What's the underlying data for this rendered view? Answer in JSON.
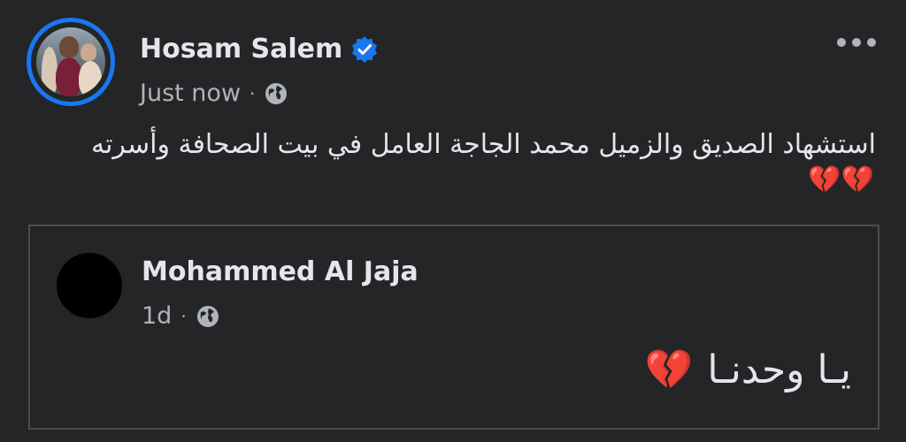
{
  "post": {
    "author": "Hosam Salem",
    "timestamp": "Just now",
    "separator": "·",
    "audience_icon": "globe-icon",
    "verified_icon": "verified-badge-icon",
    "more_icon": "more-options-icon",
    "text": "استشهاد الصديق والزميل محمد الجاجة العامل في بيت الصحافة وأسرته",
    "emojis": "💔💔"
  },
  "shared_post": {
    "author": "Mohammed Al Jaja",
    "timestamp": "1d",
    "separator": "·",
    "audience_icon": "globe-icon",
    "text": "يـا وحدنـا",
    "emoji": "💔"
  },
  "colors": {
    "background": "#242526",
    "primary_text": "#e4e6eb",
    "secondary_text": "#b0b3b8",
    "accent": "#1877f2",
    "border": "#4b4c4f"
  }
}
